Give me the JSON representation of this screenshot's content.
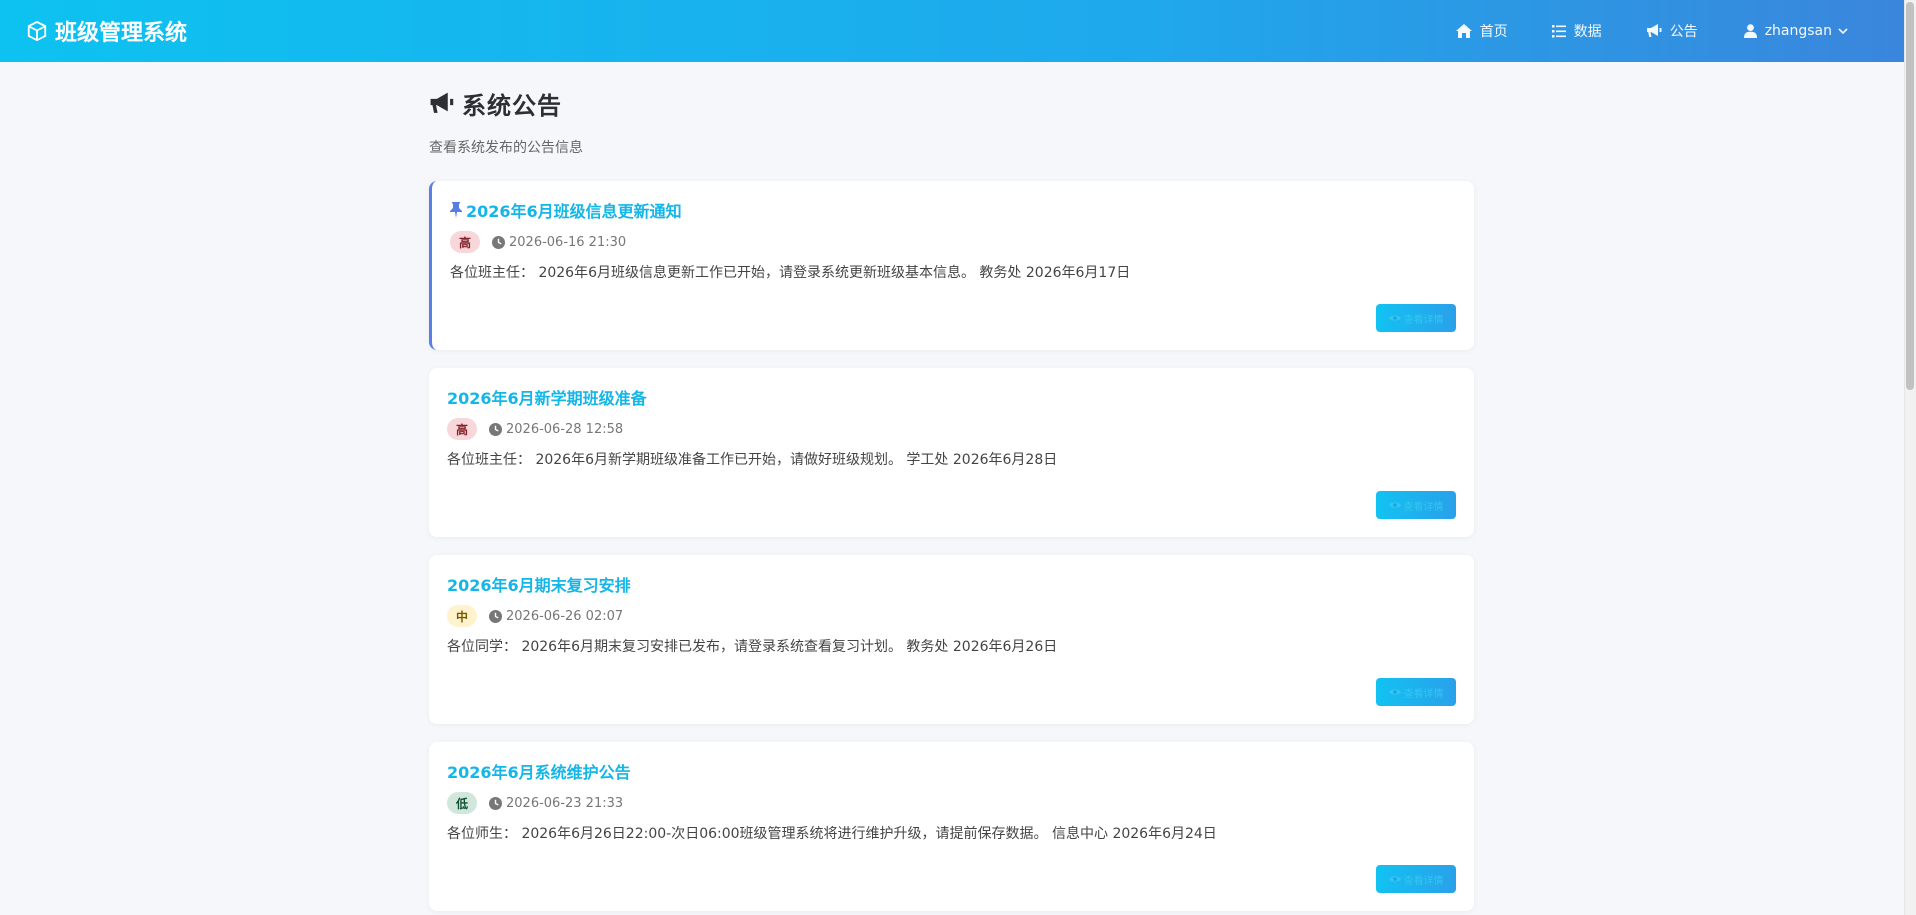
{
  "app": {
    "title": "班级管理系统",
    "nav": [
      {
        "label": "首页",
        "icon": "home-icon"
      },
      {
        "label": "数据",
        "icon": "list-icon"
      },
      {
        "label": "公告",
        "icon": "megaphone-icon"
      }
    ],
    "user": {
      "name": "zhangsan",
      "icon": "user-icon"
    }
  },
  "page": {
    "title": "系统公告",
    "subtitle": "查看系统发布的公告信息",
    "detail_label": "查看详情"
  },
  "announcements": [
    {
      "title": "2026年6月班级信息更新通知",
      "pinned": true,
      "priority": "高",
      "time": "2026-06-16 21:30",
      "content": "各位班主任： 2026年6月班级信息更新工作已开始，请登录系统更新班级基本信息。 教务处 2026年6月17日"
    },
    {
      "title": "2026年6月新学期班级准备",
      "pinned": false,
      "priority": "高",
      "time": "2026-06-28 12:58",
      "content": "各位班主任： 2026年6月新学期班级准备工作已开始，请做好班级规划。 学工处 2026年6月28日"
    },
    {
      "title": "2026年6月期末复习安排",
      "pinned": false,
      "priority": "中",
      "time": "2026-06-26 02:07",
      "content": "各位同学： 2026年6月期末复习安排已发布，请登录系统查看复习计划。 教务处 2026年6月26日"
    },
    {
      "title": "2026年6月系统维护公告",
      "pinned": false,
      "priority": "低",
      "time": "2026-06-23 21:33",
      "content": "各位师生： 2026年6月26日22:00-次日06:00班级管理系统将进行维护升级，请提前保存数据。 信息中心 2026年6月24日"
    }
  ],
  "colors": {
    "accent": "#14b6e8",
    "pinned_border": "#5b7ee5",
    "badge_high": "#f8d7da",
    "badge_mid": "#fff3cd",
    "badge_low": "#d1e7dd"
  }
}
